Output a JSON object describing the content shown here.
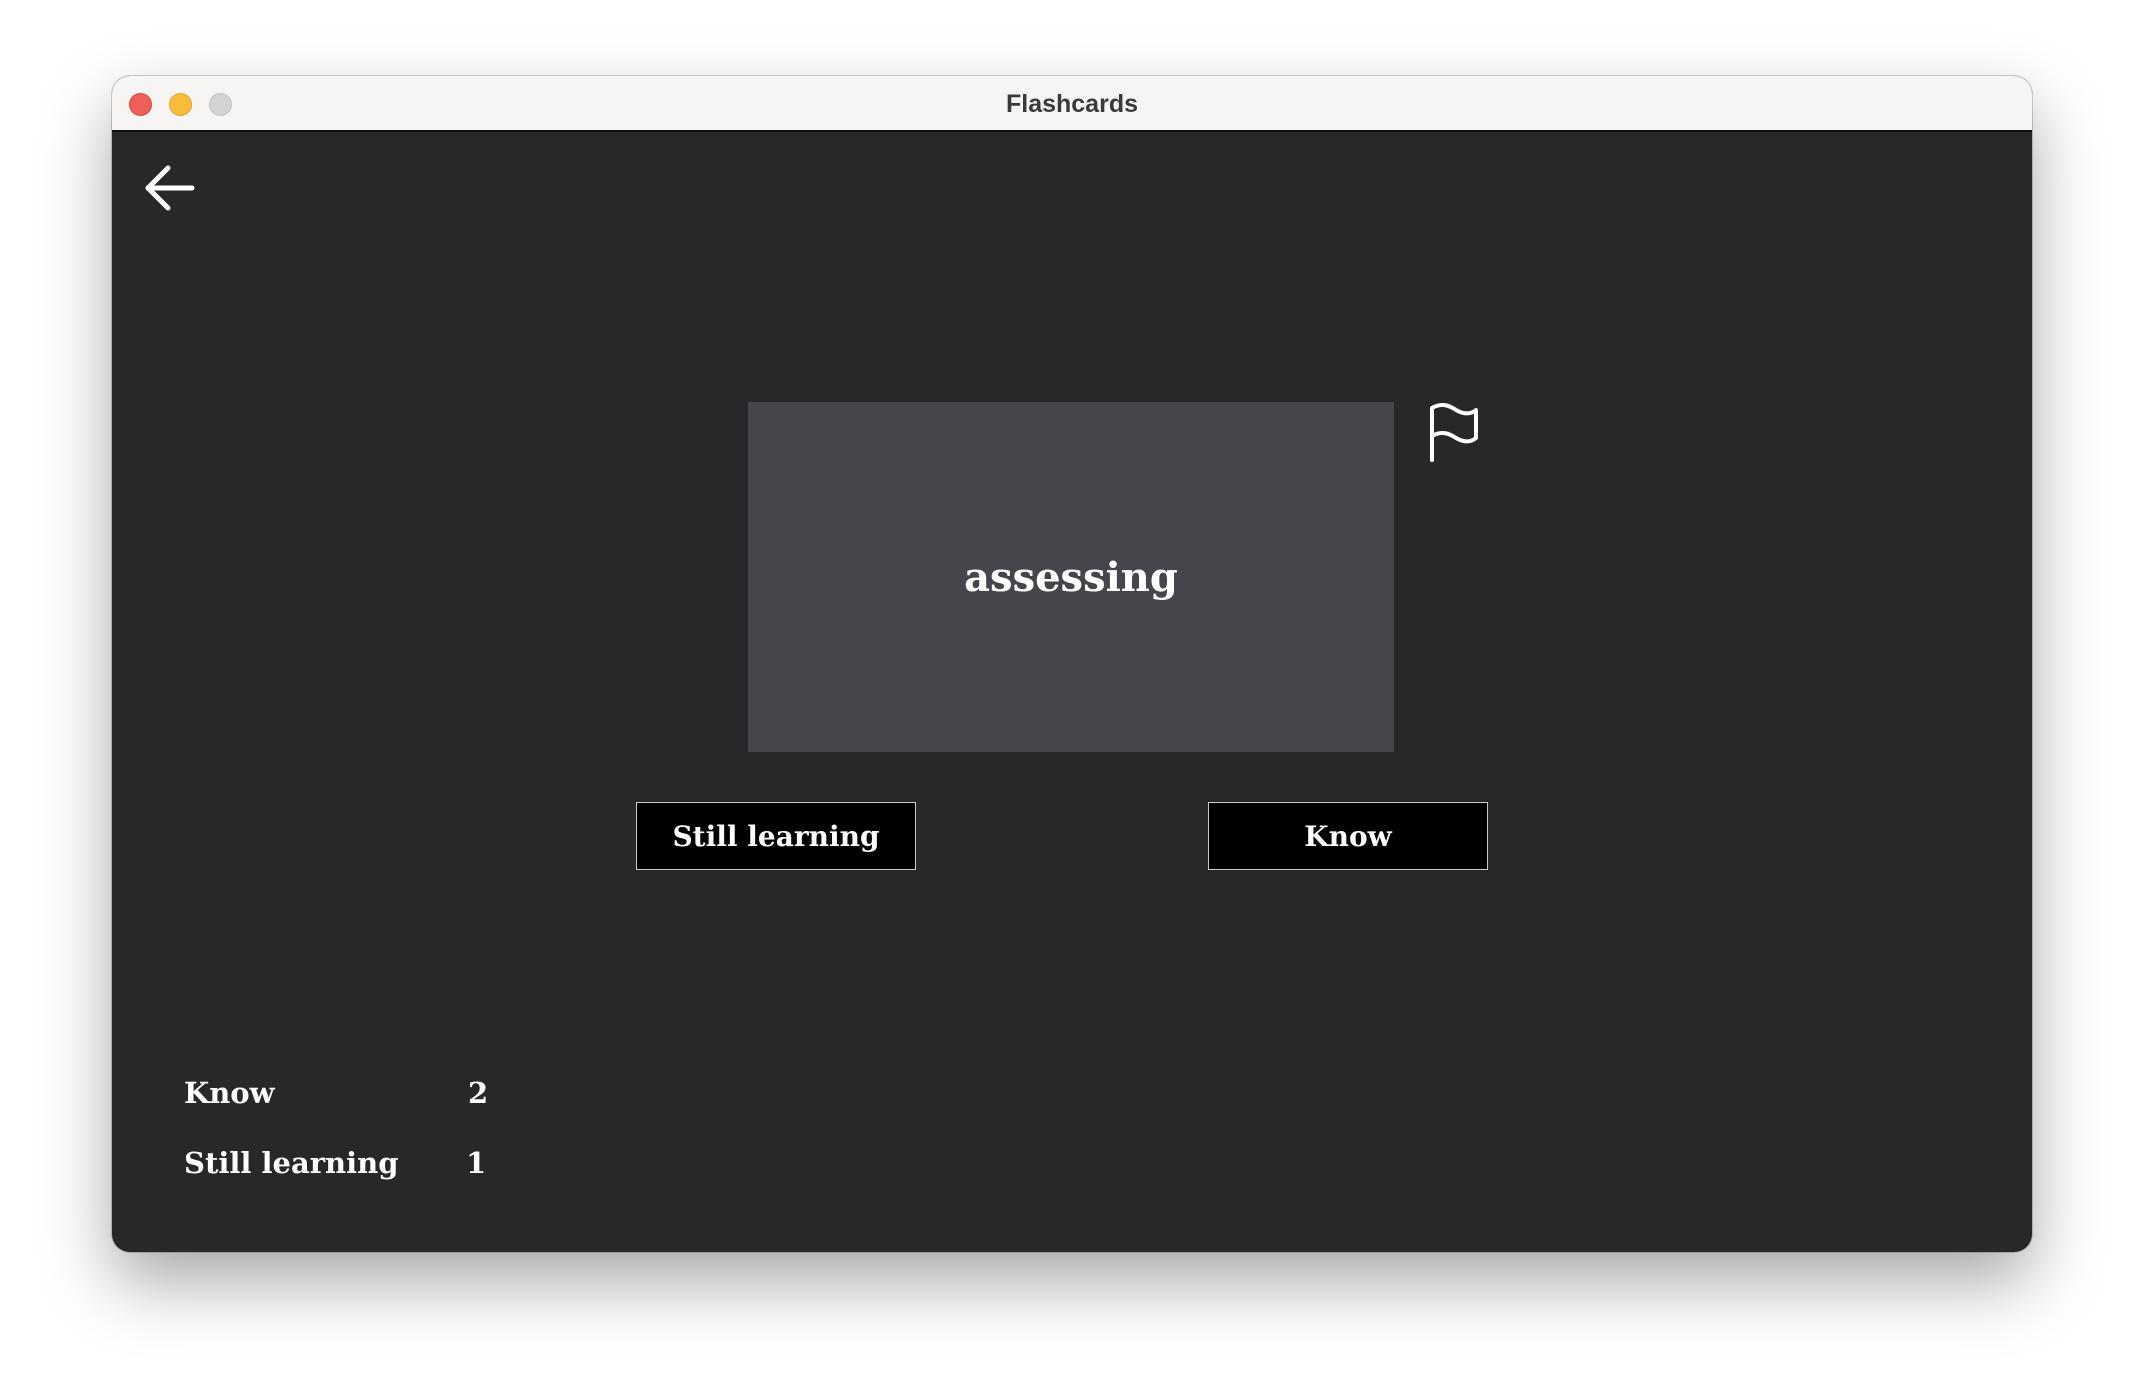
{
  "window": {
    "title": "Flashcards"
  },
  "toolbar": {
    "back_icon": "arrow-left-icon",
    "flag_icon": "flag-icon"
  },
  "card": {
    "term": "assessing",
    "background": "#45454c"
  },
  "actions": {
    "still_learning_label": "Still learning",
    "know_label": "Know"
  },
  "stats": {
    "know_label": "Know",
    "know_count": "2",
    "still_learning_label": "Still learning",
    "still_learning_count": "1"
  },
  "colors": {
    "window_background": "#282828",
    "button_background": "#000000",
    "text": "#ffffff"
  }
}
